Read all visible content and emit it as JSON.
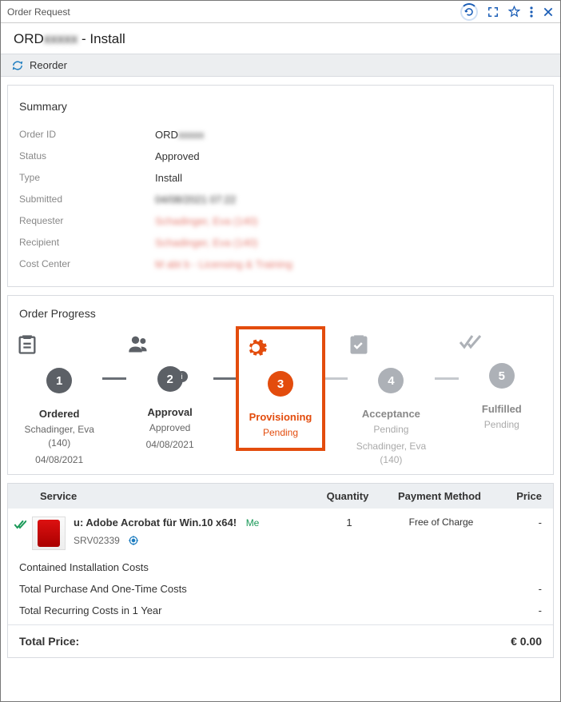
{
  "titlebar": {
    "title": "Order Request"
  },
  "header": {
    "order_id_prefix": "ORD",
    "order_id_blur": "xxxxx",
    "suffix": " - Install"
  },
  "reorder": {
    "label": "Reorder"
  },
  "summary": {
    "heading": "Summary",
    "order_id_label": "Order ID",
    "order_id_value_prefix": "ORD",
    "order_id_value_blur": "xxxxx",
    "status_label": "Status",
    "status_value": "Approved",
    "type_label": "Type",
    "type_value": "Install",
    "submitted_label": "Submitted",
    "submitted_value": "04/08/2021 07:22",
    "requester_label": "Requester",
    "requester_value": "Schadinger, Eva (140)",
    "recipient_label": "Recipient",
    "recipient_value": "Schadinger, Eva (140)",
    "costcenter_label": "Cost Center",
    "costcenter_value": "M abt b - Licensing & Training"
  },
  "progress": {
    "heading": "Order Progress",
    "steps": [
      {
        "num": "1",
        "title": "Ordered",
        "sub1": "Schadinger, Eva (140)",
        "sub2": "04/08/2021"
      },
      {
        "num": "2",
        "title": "Approval",
        "sub1": "Approved",
        "sub2": "04/08/2021"
      },
      {
        "num": "3",
        "title": "Provisioning",
        "sub1": "Pending",
        "sub2": ""
      },
      {
        "num": "4",
        "title": "Acceptance",
        "sub1": "Pending",
        "sub2": "Schadinger, Eva (140)"
      },
      {
        "num": "5",
        "title": "Fulfilled",
        "sub1": "Pending",
        "sub2": ""
      }
    ]
  },
  "table": {
    "headers": {
      "service": "Service",
      "quantity": "Quantity",
      "payment": "Payment Method",
      "price": "Price"
    },
    "row": {
      "name": "u: Adobe Acrobat für Win.10 x64!",
      "me": "Me",
      "code": "SRV02339",
      "qty": "1",
      "payment": "Free of Charge",
      "price": "-"
    },
    "costs": {
      "contained": "Contained Installation Costs",
      "onetime_label": "Total Purchase And One-Time Costs",
      "onetime_value": "-",
      "recurring_label": "Total Recurring Costs in 1 Year",
      "recurring_value": "-",
      "total_label": "Total Price:",
      "total_value": "€ 0.00"
    }
  }
}
